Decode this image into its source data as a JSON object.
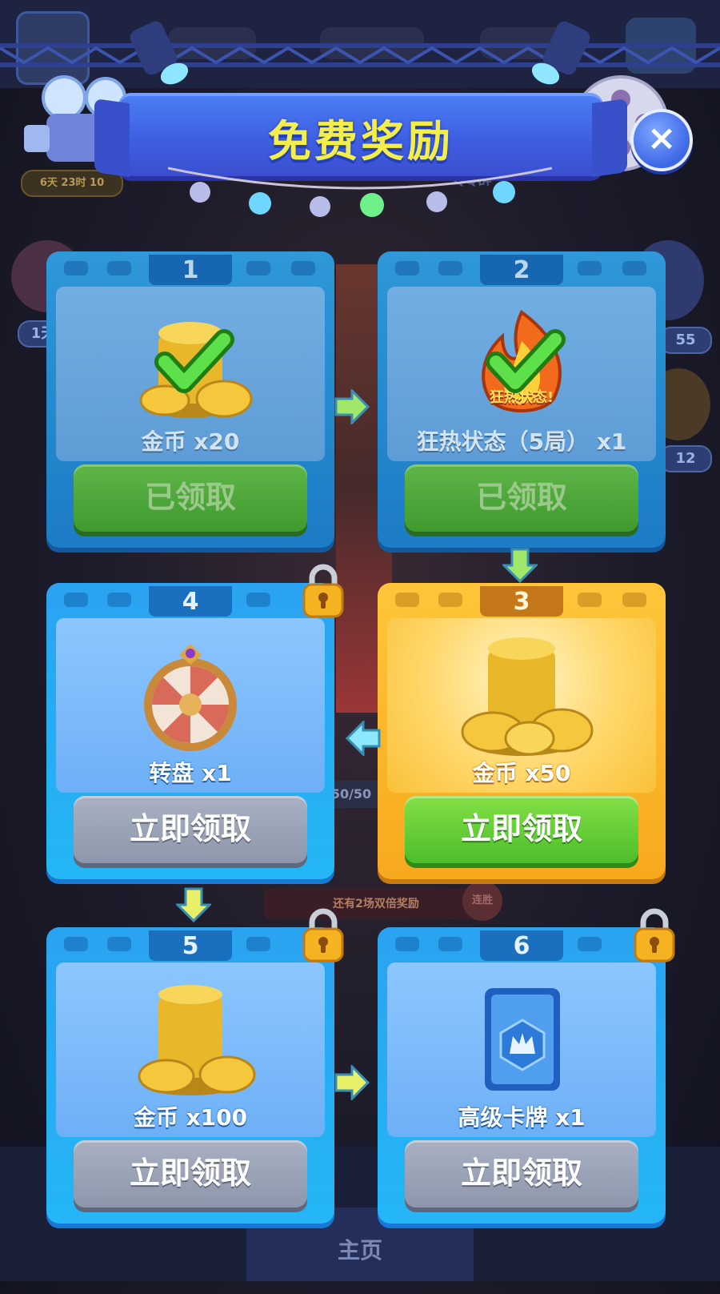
{
  "header": {
    "title": "免费奖励",
    "close_label": "×"
  },
  "background": {
    "timer_text": "6天 23时 10",
    "qq_text": "QQ群",
    "left_badge": "1天",
    "right_badge_1": "55",
    "right_badge_2": "12",
    "progress_text": "50/50",
    "double_reward_text": "还有2场双倍奖励",
    "streak_text": "连胜",
    "home_tab": "主页"
  },
  "rewards": [
    {
      "step": "1",
      "label": "金币 x20",
      "button": "已领取",
      "status": "claimed",
      "icon": "gold-coins-icon"
    },
    {
      "step": "2",
      "label": "狂热状态（5局） x1",
      "button": "已领取",
      "status": "claimed",
      "icon": "frenzy-flame-icon",
      "icon_caption": "狂热状态!"
    },
    {
      "step": "3",
      "label": "金币 x50",
      "button": "立即领取",
      "status": "available",
      "icon": "gold-coins-icon"
    },
    {
      "step": "4",
      "label": "转盘 x1",
      "button": "立即领取",
      "status": "locked",
      "icon": "prize-wheel-icon"
    },
    {
      "step": "5",
      "label": "金币 x100",
      "button": "立即领取",
      "status": "locked",
      "icon": "gold-coins-icon"
    },
    {
      "step": "6",
      "label": "高级卡牌 x1",
      "button": "立即领取",
      "status": "locked",
      "icon": "premium-card-icon"
    }
  ],
  "colors": {
    "banner_title": "#f4ee4a",
    "claim_green": "#4cbd2a",
    "disabled_gray": "#8e96ab",
    "active_card": "#ffc53a"
  }
}
